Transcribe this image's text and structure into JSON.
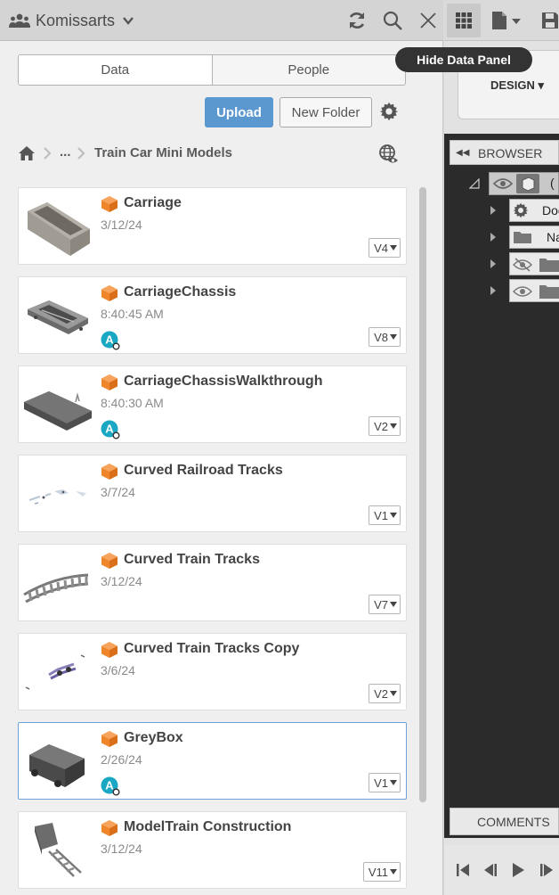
{
  "team": {
    "name": "Komissarts"
  },
  "tabs": [
    {
      "label": "Data"
    },
    {
      "label": "People"
    }
  ],
  "actions": {
    "upload_label": "Upload",
    "new_folder_label": "New Folder"
  },
  "breadcrumb": {
    "ellipsis": "...",
    "current": "Train Car Mini Models"
  },
  "tooltip": {
    "text": "Hide Data Panel"
  },
  "workspace": {
    "label": "DESIGN ▾"
  },
  "browser": {
    "label": "BROWSER",
    "rows": [
      {
        "text": "("
      },
      {
        "text": "Doc"
      },
      {
        "text": "Na"
      }
    ]
  },
  "comments": {
    "label": "COMMENTS"
  },
  "files": [
    {
      "name": "Carriage",
      "date": "3/12/24",
      "version": "V4",
      "avatar": ""
    },
    {
      "name": "CarriageChassis",
      "date": "8:40:45 AM",
      "version": "V8",
      "avatar": "A"
    },
    {
      "name": "CarriageChassisWalkthrough",
      "date": "8:40:30 AM",
      "version": "V2",
      "avatar": "A"
    },
    {
      "name": "Curved Railroad Tracks",
      "date": "3/7/24",
      "version": "V1",
      "avatar": ""
    },
    {
      "name": "Curved Train Tracks",
      "date": "3/12/24",
      "version": "V7",
      "avatar": ""
    },
    {
      "name": "Curved Train Tracks Copy",
      "date": "3/6/24",
      "version": "V2",
      "avatar": ""
    },
    {
      "name": "GreyBox",
      "date": "2/26/24",
      "version": "V1",
      "avatar": "A"
    },
    {
      "name": "ModelTrain Construction",
      "date": "3/12/24",
      "version": "V11",
      "avatar": ""
    }
  ],
  "colors": {
    "accent": "#5b98cf",
    "file_icon": "#f0862c",
    "avatar": "#1aa7c4",
    "selected_border": "#6fa2d6"
  }
}
